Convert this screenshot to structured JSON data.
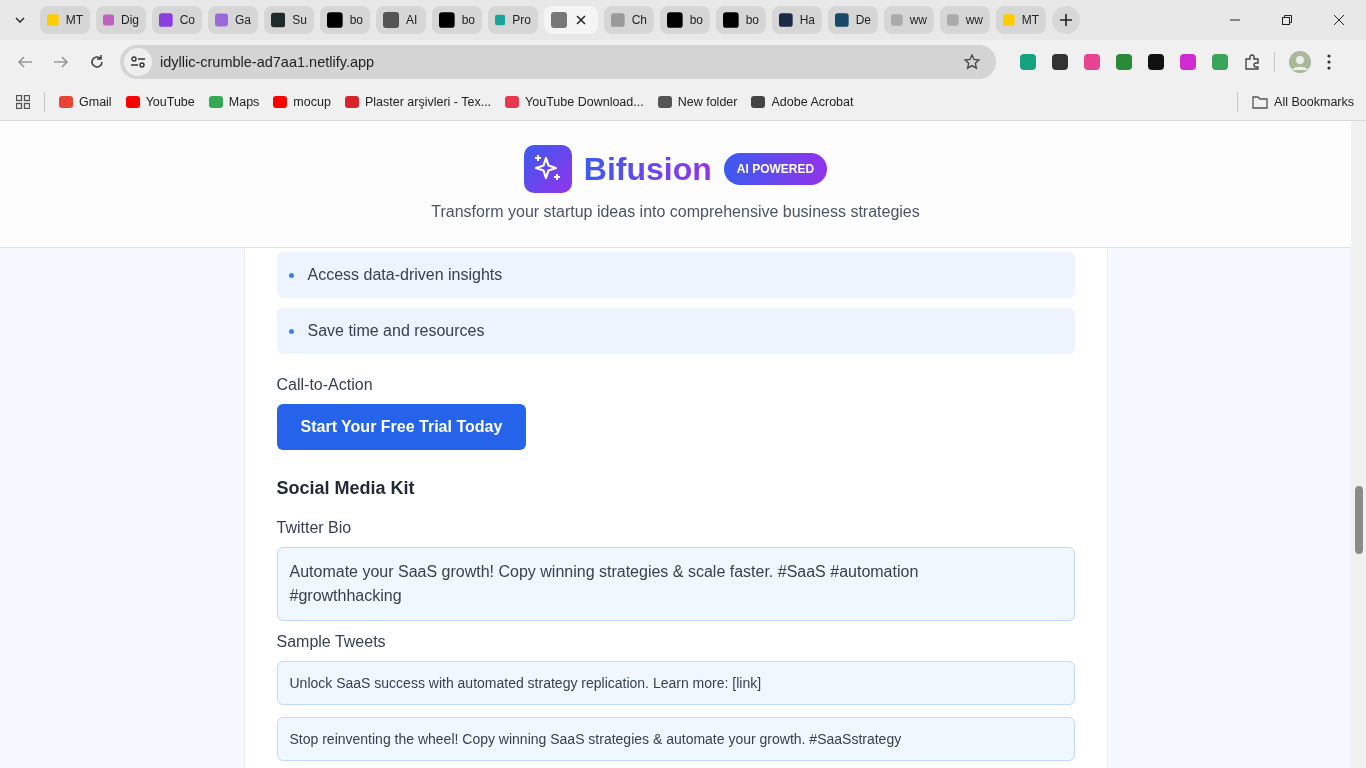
{
  "browser": {
    "tabs": [
      {
        "title": "MT",
        "selected": false,
        "color": "#ffcc00"
      },
      {
        "title": "Dig",
        "selected": false,
        "color": "#c060c0"
      },
      {
        "title": "Co",
        "selected": false,
        "color": "#8b3fe0"
      },
      {
        "title": "Ga",
        "selected": false,
        "color": "#9a6ad8"
      },
      {
        "title": "Su",
        "selected": false,
        "color": "#1f2a2a"
      },
      {
        "title": "bo",
        "selected": false,
        "color": "#000000"
      },
      {
        "title": "AI",
        "selected": false,
        "color": "#555555"
      },
      {
        "title": "bo",
        "selected": false,
        "color": "#000000"
      },
      {
        "title": "Pro",
        "selected": false,
        "color": "#1aa39a"
      },
      {
        "selected": true,
        "color": "#777777"
      },
      {
        "title": "Ch",
        "selected": false,
        "color": "#999999"
      },
      {
        "title": "bo",
        "selected": false,
        "color": "#000000"
      },
      {
        "title": "bo",
        "selected": false,
        "color": "#000000"
      },
      {
        "title": "Ha",
        "selected": false,
        "color": "#1b2a45"
      },
      {
        "title": "De",
        "selected": false,
        "color": "#174a6a"
      },
      {
        "title": "ww",
        "selected": false,
        "color": "#aaaaaa"
      },
      {
        "title": "ww",
        "selected": false,
        "color": "#aaaaaa"
      },
      {
        "title": "MT",
        "selected": false,
        "color": "#ffcc00"
      }
    ],
    "address": "idyllic-crumble-ad7aa1.netlify.app",
    "extensions": [
      {
        "color": "#15a37f"
      },
      {
        "color": "#333333"
      },
      {
        "color": "#e84393"
      },
      {
        "color": "#2a8a3a"
      },
      {
        "color": "#111111"
      },
      {
        "color": "#d02bd0"
      },
      {
        "color": "#3aa55a"
      }
    ],
    "bookmarks": [
      {
        "title": "Gmail",
        "color": "#ea4335"
      },
      {
        "title": "YouTube",
        "color": "#ff0000"
      },
      {
        "title": "Maps",
        "color": "#34a853"
      },
      {
        "title": "mocup",
        "color": "#ff0000"
      },
      {
        "title": "Plaster arşivleri - Tex...",
        "color": "#d8232a"
      },
      {
        "title": "YouTube Download...",
        "color": "#e8384f"
      },
      {
        "title": "New folder",
        "color": "#555555"
      },
      {
        "title": "Adobe Acrobat",
        "color": "#444444"
      }
    ],
    "all_bookmarks": "All Bookmarks"
  },
  "header": {
    "brand": "Bifusion",
    "badge": "AI POWERED",
    "tagline": "Transform your startup ideas into comprehensive business strategies"
  },
  "benefits": [
    "Access data-driven insights",
    "Save time and resources"
  ],
  "cta": {
    "label": "Call-to-Action",
    "button": "Start Your Free Trial Today"
  },
  "social": {
    "heading": "Social Media Kit",
    "bio_label": "Twitter Bio",
    "bio": "Automate your SaaS growth! Copy winning strategies & scale faster. #SaaS #automation #growthhacking",
    "tweets_label": "Sample Tweets",
    "tweets": [
      "Unlock SaaS success with automated strategy replication. Learn more: [link]",
      "Stop reinventing the wheel! Copy winning SaaS strategies & automate your growth. #SaaSstrategy"
    ]
  }
}
